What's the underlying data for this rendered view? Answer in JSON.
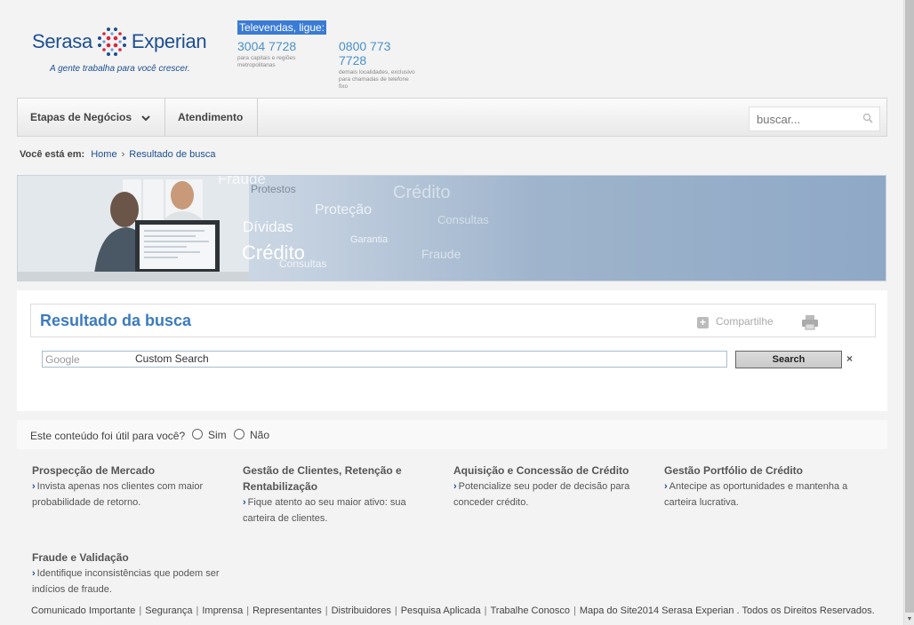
{
  "header": {
    "logo": {
      "brand_left": "Serasa",
      "brand_right": "Experian",
      "tagline": "A gente trabalha para você crescer."
    },
    "televendas": {
      "label": "Televendas, ligue:",
      "phones": [
        {
          "number": "3004 7728",
          "note": "para capitais e regiões metropolitanas"
        },
        {
          "number": "0800 773 7728",
          "note": "demais localidades, exclusivo para chamadas de telefone fixo"
        }
      ]
    }
  },
  "nav": {
    "items": [
      {
        "label": "Etapas de Negócios",
        "icon": "chevron-down-icon"
      },
      {
        "label": "Atendimento"
      }
    ],
    "search_placeholder": "buscar..."
  },
  "breadcrumb": {
    "label": "Você está em:",
    "home": "Home",
    "current": "Resultado de busca"
  },
  "banner": {
    "words": [
      "Fraude",
      "Protestos",
      "Crédito",
      "Proteção",
      "Consultas",
      "Dívidas",
      "Crédito",
      "Garantia",
      "Consultas",
      "Fraude"
    ]
  },
  "results": {
    "title": "Resultado da busca",
    "share_label": "Compartilhe",
    "search_input_brand": "Google",
    "search_input_text": "Custom Search",
    "search_button": "Search",
    "clear_symbol": "×"
  },
  "feedback": {
    "question": "Este conteúdo foi útil para você?",
    "yes": "Sim",
    "no": "Não"
  },
  "columns": [
    {
      "title": "Prospecção de Mercado",
      "text": "Invista apenas nos clientes com maior probabilidade de retorno."
    },
    {
      "title": "Gestão de Clientes, Retenção e Rentabilização",
      "text": "Fique atento ao seu maior ativo: sua carteira de clientes."
    },
    {
      "title": "Aquisição e Concessão de Crédito",
      "text": "Potencialize seu poder de decisão para conceder crédito."
    },
    {
      "title": "Gestão Portfólio de Crédito",
      "text": "Antecipe as oportunidades e mantenha a carteira lucrativa."
    },
    {
      "title": "Fraude e Validação",
      "text": "Identifique inconsistências que podem ser indícios de fraude."
    }
  ],
  "footer": {
    "links": [
      "Comunicado Importante",
      "Segurança",
      "Imprensa",
      "Representantes",
      "Distribuidores",
      "Pesquisa Aplicada",
      "Trabalhe Conosco",
      "Mapa do Site"
    ],
    "copyright": "2014 Serasa Experian . Todos os Direitos Reservados."
  }
}
